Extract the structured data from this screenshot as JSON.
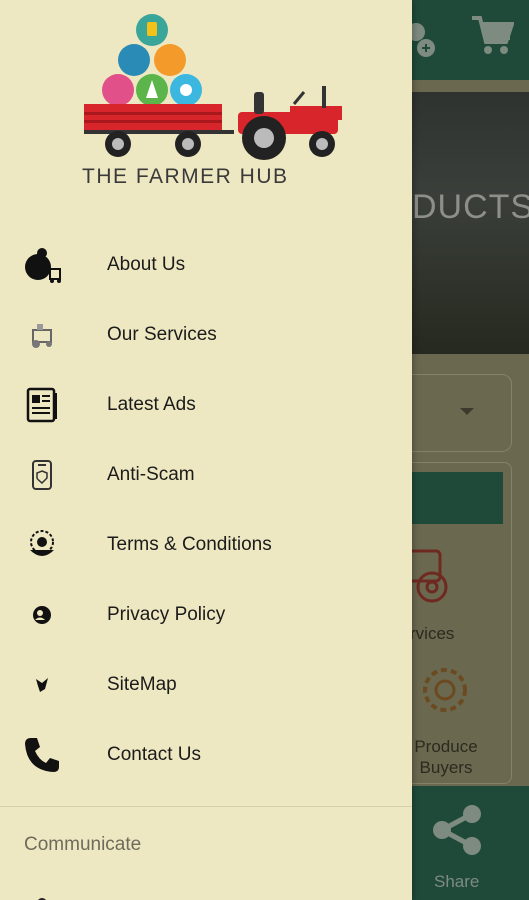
{
  "background": {
    "hero_text": "DUCTS",
    "services_label": "rvices",
    "produce_label_line1": "Produce",
    "produce_label_line2": "Buyers",
    "share_label": "Share"
  },
  "drawer": {
    "brand": "THE FARMER HUB",
    "items": [
      {
        "label": "About Us",
        "icon": "farmer-icon"
      },
      {
        "label": "Our Services",
        "icon": "tractor-service-icon"
      },
      {
        "label": "Latest Ads",
        "icon": "newspaper-icon"
      },
      {
        "label": "Anti-Scam",
        "icon": "phone-shield-icon"
      },
      {
        "label": "Terms & Conditions",
        "icon": "handshake-globe-icon"
      },
      {
        "label": "Privacy Policy",
        "icon": "privacy-icon"
      },
      {
        "label": "SiteMap",
        "icon": "sitemap-icon"
      },
      {
        "label": "Contact Us",
        "icon": "phone-icon"
      }
    ],
    "section_title": "Communicate"
  },
  "colors": {
    "drawer_bg": "#eee8c2",
    "topbar": "#1f4a3a",
    "tractor_red": "#d8242b",
    "text": "#1b1b1b"
  }
}
